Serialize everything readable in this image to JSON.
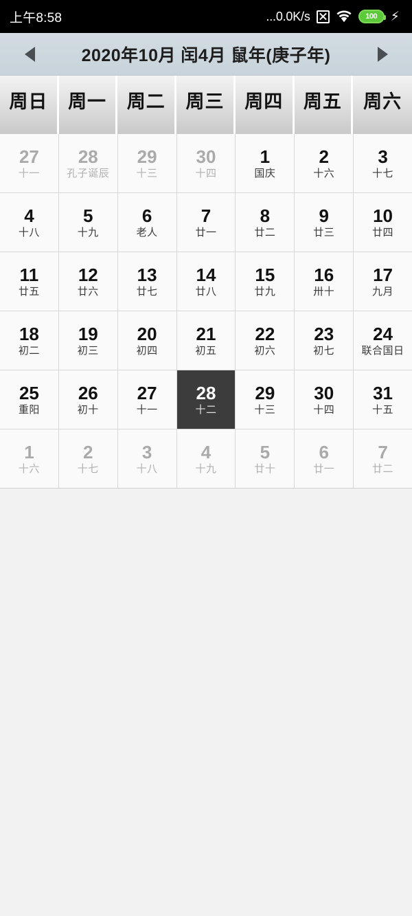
{
  "status_bar": {
    "clock": "上午8:58",
    "network_speed": "...0.0K/s",
    "no_sim_icon": "x-box-icon",
    "wifi_icon": "wifi-icon",
    "battery_level": "100",
    "battery_icon": "battery-icon",
    "charging_icon": "⚡",
    "colors": {
      "background": "#000000",
      "text": "#ffffff",
      "battery_green": "#5cc93a"
    }
  },
  "month_header": {
    "prev_label": "◀",
    "next_label": "▶",
    "title": "2020年10月 闰4月 鼠年(庚子年)",
    "background": "#cdd7de"
  },
  "weekdays": [
    "周日",
    "周一",
    "周二",
    "周三",
    "周四",
    "周五",
    "周六"
  ],
  "calendar": {
    "selected_day": "28",
    "selected_color": "#3c3c3c",
    "weeks": [
      [
        {
          "num": "27",
          "lunar": "十一",
          "outside": true,
          "selected": false
        },
        {
          "num": "28",
          "lunar": "孔子诞辰",
          "outside": true,
          "selected": false
        },
        {
          "num": "29",
          "lunar": "十三",
          "outside": true,
          "selected": false
        },
        {
          "num": "30",
          "lunar": "十四",
          "outside": true,
          "selected": false
        },
        {
          "num": "1",
          "lunar": "国庆",
          "outside": false,
          "selected": false
        },
        {
          "num": "2",
          "lunar": "十六",
          "outside": false,
          "selected": false
        },
        {
          "num": "3",
          "lunar": "十七",
          "outside": false,
          "selected": false
        }
      ],
      [
        {
          "num": "4",
          "lunar": "十八",
          "outside": false,
          "selected": false
        },
        {
          "num": "5",
          "lunar": "十九",
          "outside": false,
          "selected": false
        },
        {
          "num": "6",
          "lunar": "老人",
          "outside": false,
          "selected": false
        },
        {
          "num": "7",
          "lunar": "廿一",
          "outside": false,
          "selected": false
        },
        {
          "num": "8",
          "lunar": "廿二",
          "outside": false,
          "selected": false
        },
        {
          "num": "9",
          "lunar": "廿三",
          "outside": false,
          "selected": false
        },
        {
          "num": "10",
          "lunar": "廿四",
          "outside": false,
          "selected": false
        }
      ],
      [
        {
          "num": "11",
          "lunar": "廿五",
          "outside": false,
          "selected": false
        },
        {
          "num": "12",
          "lunar": "廿六",
          "outside": false,
          "selected": false
        },
        {
          "num": "13",
          "lunar": "廿七",
          "outside": false,
          "selected": false
        },
        {
          "num": "14",
          "lunar": "廿八",
          "outside": false,
          "selected": false
        },
        {
          "num": "15",
          "lunar": "廿九",
          "outside": false,
          "selected": false
        },
        {
          "num": "16",
          "lunar": "卅十",
          "outside": false,
          "selected": false
        },
        {
          "num": "17",
          "lunar": "九月",
          "outside": false,
          "selected": false
        }
      ],
      [
        {
          "num": "18",
          "lunar": "初二",
          "outside": false,
          "selected": false
        },
        {
          "num": "19",
          "lunar": "初三",
          "outside": false,
          "selected": false
        },
        {
          "num": "20",
          "lunar": "初四",
          "outside": false,
          "selected": false
        },
        {
          "num": "21",
          "lunar": "初五",
          "outside": false,
          "selected": false
        },
        {
          "num": "22",
          "lunar": "初六",
          "outside": false,
          "selected": false
        },
        {
          "num": "23",
          "lunar": "初七",
          "outside": false,
          "selected": false
        },
        {
          "num": "24",
          "lunar": "联合国日",
          "outside": false,
          "selected": false
        }
      ],
      [
        {
          "num": "25",
          "lunar": "重阳",
          "outside": false,
          "selected": false
        },
        {
          "num": "26",
          "lunar": "初十",
          "outside": false,
          "selected": false
        },
        {
          "num": "27",
          "lunar": "十一",
          "outside": false,
          "selected": false
        },
        {
          "num": "28",
          "lunar": "十二",
          "outside": false,
          "selected": true
        },
        {
          "num": "29",
          "lunar": "十三",
          "outside": false,
          "selected": false
        },
        {
          "num": "30",
          "lunar": "十四",
          "outside": false,
          "selected": false
        },
        {
          "num": "31",
          "lunar": "十五",
          "outside": false,
          "selected": false
        }
      ],
      [
        {
          "num": "1",
          "lunar": "十六",
          "outside": true,
          "selected": false
        },
        {
          "num": "2",
          "lunar": "十七",
          "outside": true,
          "selected": false
        },
        {
          "num": "3",
          "lunar": "十八",
          "outside": true,
          "selected": false
        },
        {
          "num": "4",
          "lunar": "十九",
          "outside": true,
          "selected": false
        },
        {
          "num": "5",
          "lunar": "廿十",
          "outside": true,
          "selected": false
        },
        {
          "num": "6",
          "lunar": "廿一",
          "outside": true,
          "selected": false
        },
        {
          "num": "7",
          "lunar": "廿二",
          "outside": true,
          "selected": false
        }
      ]
    ]
  }
}
